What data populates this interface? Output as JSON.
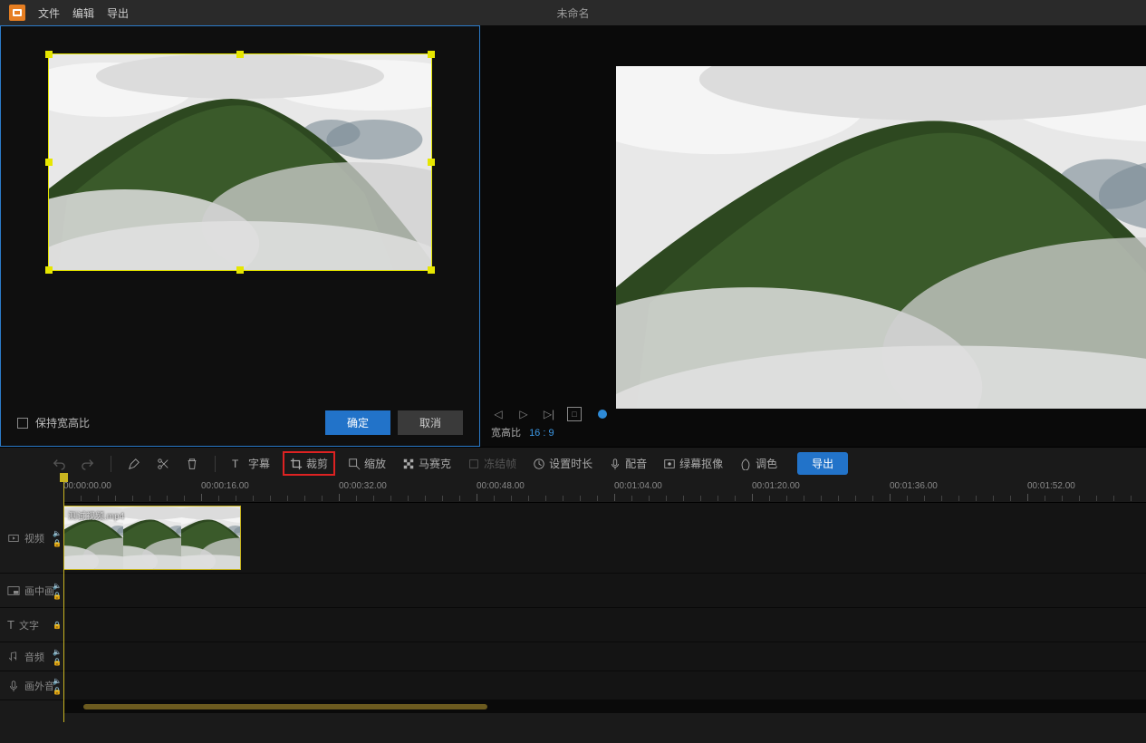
{
  "menubar": {
    "file": "文件",
    "edit": "编辑",
    "export": "导出",
    "title": "未命名"
  },
  "crop": {
    "keep_ratio": "保持宽高比",
    "ok": "确定",
    "cancel": "取消"
  },
  "preview": {
    "aspect_label": "宽高比",
    "aspect_value": "16 : 9"
  },
  "toolbar": {
    "subtitle": "字幕",
    "crop": "裁剪",
    "zoom": "缩放",
    "mosaic": "马赛克",
    "freeze": "冻结帧",
    "duration": "设置时长",
    "dub": "配音",
    "greenscreen": "绿幕抠像",
    "color": "调色",
    "export": "导出"
  },
  "ruler": {
    "marks": [
      "00:00:00.00",
      "00:00:16.00",
      "00:00:32.00",
      "00:00:48.00",
      "00:01:04.00",
      "00:01:20.00",
      "00:01:36.00",
      "00:01:52.00"
    ]
  },
  "tracks": {
    "video": "视频",
    "pip": "画中画",
    "text": "文字",
    "audio": "音频",
    "voice": "画外音"
  },
  "clip": {
    "name": "测试视频.mp4"
  }
}
